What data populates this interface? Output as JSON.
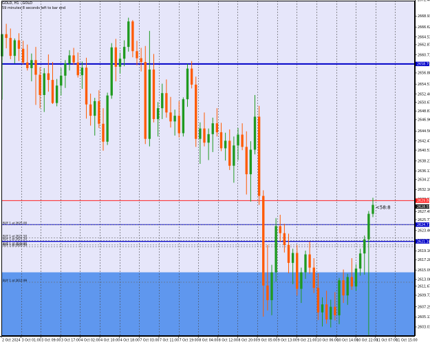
{
  "header": {
    "symbol_line": "GOLD, H1 - GOLD",
    "timer_line": "59 minutes 8 seconds left to bar end"
  },
  "colors": {
    "background": "#e6e6fa",
    "grid": "#4a4a4a",
    "bull": "#1f9a1f",
    "bear": "#ff5a00",
    "blue_line": "#0000c8",
    "red_line": "#ff2020",
    "zone": "#5f97ee",
    "axis_bg": "#ffffff"
  },
  "price_axis": {
    "min": 2601.1,
    "max": 2672.2,
    "ticks": [
      "2672.40",
      "2668.93",
      "2666.62",
      "2664.53",
      "2662.87",
      "2660.71",
      "2658.79",
      "2656.88",
      "2654.51",
      "2652.40",
      "2650.67",
      "2648.81",
      "2646.96",
      "2644.56",
      "2642.47",
      "2640.51",
      "2638.21",
      "2636.11",
      "2634.27",
      "2632.16",
      "2630.11",
      "2627.49",
      "2625.77",
      "2623.46",
      "2621.39",
      "2619.16",
      "2617.28",
      "2615.09",
      "2613.08",
      "2611.67",
      "2609.73",
      "2607.29",
      "2605.13",
      "2603.01"
    ],
    "markers": [
      {
        "label": "2658.79",
        "color": "#0000c8"
      },
      {
        "label": "2629.80",
        "color": "#ff2020"
      },
      {
        "label": "2628.55",
        "color": "#1a1a1a"
      },
      {
        "label": "2624.71",
        "color": "#0000c8"
      },
      {
        "label": "2621.16",
        "color": "#0000c8"
      }
    ]
  },
  "time_axis": {
    "labels": [
      "2 Oct 2024",
      "3 Oct 01:00",
      "3 Oct 09:00",
      "3 Oct 17:00",
      "4 Oct 02:00",
      "4 Oct 10:00",
      "4 Oct 18:00",
      "7 Oct 03:00",
      "7 Oct 11:00",
      "7 Oct 19:00",
      "8 Oct 04:00",
      "8 Oct 12:00",
      "8 Oct 20:00",
      "9 Oct 05:00",
      "9 Oct 13:00",
      "9 Oct 21:00",
      "10 Oct 06:00",
      "10 Oct 14:00",
      "10 Oct 22:00",
      "11 Oct 07:00",
      "11 Oct 15:00"
    ]
  },
  "levels": {
    "blue_top": 2658.79,
    "red_line": 2629.8,
    "blue_mid1": 2624.71,
    "blue_mid2": 2621.16
  },
  "zone": {
    "from": 2601.1,
    "to": 2614.6
  },
  "orders": [
    {
      "label": "BUY 1 at 2625.00",
      "price": 2624.71
    },
    {
      "label": "BUY 1 at 2621.50",
      "price": 2621.9
    },
    {
      "label": "BUY 1 at 2621.20",
      "price": 2621.3
    },
    {
      "label": "BUY 1 at 2620.80",
      "price": 2620.4
    },
    {
      "label": "BUY 1 at 2620.50",
      "price": 2620.0
    },
    {
      "label": "BUY 1 at 2612.99",
      "price": 2612.5
    }
  ],
  "current_price_label": "<58:8",
  "chart_data": {
    "type": "candlestick",
    "series": [
      {
        "o": 2660.4,
        "h": 2665.1,
        "l": 2651.2,
        "c": 2665.1
      },
      {
        "o": 2665.1,
        "h": 2667.3,
        "l": 2662.1,
        "c": 2664.3
      },
      {
        "o": 2664.3,
        "h": 2666.3,
        "l": 2659.8,
        "c": 2660.5
      },
      {
        "o": 2660.5,
        "h": 2664.2,
        "l": 2658.9,
        "c": 2663.8
      },
      {
        "o": 2663.8,
        "h": 2665.3,
        "l": 2659.4,
        "c": 2662.0
      },
      {
        "o": 2662.0,
        "h": 2663.7,
        "l": 2658.7,
        "c": 2659.1
      },
      {
        "o": 2659.1,
        "h": 2662.9,
        "l": 2657.4,
        "c": 2657.9
      },
      {
        "o": 2657.9,
        "h": 2661.0,
        "l": 2655.1,
        "c": 2659.6
      },
      {
        "o": 2659.6,
        "h": 2662.4,
        "l": 2650.1,
        "c": 2656.5
      },
      {
        "o": 2656.5,
        "h": 2658.1,
        "l": 2649.4,
        "c": 2652.2
      },
      {
        "o": 2652.2,
        "h": 2657.9,
        "l": 2648.6,
        "c": 2656.8
      },
      {
        "o": 2656.8,
        "h": 2660.8,
        "l": 2652.9,
        "c": 2655.4
      },
      {
        "o": 2655.4,
        "h": 2659.2,
        "l": 2650.3,
        "c": 2650.5
      },
      {
        "o": 2650.5,
        "h": 2655.6,
        "l": 2649.8,
        "c": 2654.2
      },
      {
        "o": 2654.2,
        "h": 2657.9,
        "l": 2652.1,
        "c": 2656.3
      },
      {
        "o": 2656.3,
        "h": 2659.6,
        "l": 2653.7,
        "c": 2658.9
      },
      {
        "o": 2658.9,
        "h": 2661.7,
        "l": 2657.4,
        "c": 2660.6
      },
      {
        "o": 2660.6,
        "h": 2662.2,
        "l": 2658.6,
        "c": 2659.1
      },
      {
        "o": 2659.1,
        "h": 2661.2,
        "l": 2655.9,
        "c": 2656.4
      },
      {
        "o": 2656.4,
        "h": 2659.3,
        "l": 2653.5,
        "c": 2658.0
      },
      {
        "o": 2658.0,
        "h": 2660.1,
        "l": 2647.2,
        "c": 2650.2
      },
      {
        "o": 2650.2,
        "h": 2652.5,
        "l": 2645.7,
        "c": 2647.8
      },
      {
        "o": 2647.8,
        "h": 2651.6,
        "l": 2643.6,
        "c": 2650.9
      },
      {
        "o": 2650.9,
        "h": 2653.2,
        "l": 2645.2,
        "c": 2646.1
      },
      {
        "o": 2646.1,
        "h": 2649.4,
        "l": 2640.4,
        "c": 2642.3
      },
      {
        "o": 2642.3,
        "h": 2652.7,
        "l": 2641.6,
        "c": 2652.1
      },
      {
        "o": 2652.1,
        "h": 2663.2,
        "l": 2651.4,
        "c": 2662.3
      },
      {
        "o": 2662.3,
        "h": 2664.1,
        "l": 2655.1,
        "c": 2658.2
      },
      {
        "o": 2658.2,
        "h": 2661.2,
        "l": 2656.7,
        "c": 2659.9
      },
      {
        "o": 2659.9,
        "h": 2663.8,
        "l": 2658.3,
        "c": 2662.4
      },
      {
        "o": 2662.4,
        "h": 2668.6,
        "l": 2661.4,
        "c": 2667.8
      },
      {
        "o": 2667.8,
        "h": 2668.1,
        "l": 2660.2,
        "c": 2661.5
      },
      {
        "o": 2661.5,
        "h": 2663.7,
        "l": 2658.5,
        "c": 2660.0
      },
      {
        "o": 2660.0,
        "h": 2662.2,
        "l": 2657.2,
        "c": 2659.2
      },
      {
        "o": 2659.2,
        "h": 2662.6,
        "l": 2641.8,
        "c": 2642.9
      },
      {
        "o": 2642.9,
        "h": 2665.8,
        "l": 2641.3,
        "c": 2657.6
      },
      {
        "o": 2657.6,
        "h": 2660.9,
        "l": 2646.4,
        "c": 2647.1
      },
      {
        "o": 2647.1,
        "h": 2650.7,
        "l": 2643.4,
        "c": 2649.4
      },
      {
        "o": 2649.4,
        "h": 2654.6,
        "l": 2647.1,
        "c": 2652.6
      },
      {
        "o": 2652.6,
        "h": 2655.5,
        "l": 2647.4,
        "c": 2648.5
      },
      {
        "o": 2648.5,
        "h": 2651.8,
        "l": 2645.3,
        "c": 2646.6
      },
      {
        "o": 2646.6,
        "h": 2649.1,
        "l": 2643.6,
        "c": 2647.8
      },
      {
        "o": 2647.8,
        "h": 2650.9,
        "l": 2643.2,
        "c": 2644.1
      },
      {
        "o": 2644.1,
        "h": 2651.7,
        "l": 2643.4,
        "c": 2651.3
      },
      {
        "o": 2651.3,
        "h": 2658.8,
        "l": 2649.7,
        "c": 2657.8
      },
      {
        "o": 2657.8,
        "h": 2659.4,
        "l": 2653.6,
        "c": 2654.4
      },
      {
        "o": 2654.4,
        "h": 2656.1,
        "l": 2641.2,
        "c": 2642.9
      },
      {
        "o": 2642.9,
        "h": 2646.4,
        "l": 2637.6,
        "c": 2645.1
      },
      {
        "o": 2645.1,
        "h": 2648.5,
        "l": 2641.3,
        "c": 2642.1
      },
      {
        "o": 2642.1,
        "h": 2645.1,
        "l": 2638.4,
        "c": 2643.9
      },
      {
        "o": 2643.9,
        "h": 2647.4,
        "l": 2640.1,
        "c": 2646.2
      },
      {
        "o": 2646.2,
        "h": 2649.4,
        "l": 2643.4,
        "c": 2644.3
      },
      {
        "o": 2644.3,
        "h": 2646.3,
        "l": 2640.3,
        "c": 2640.9
      },
      {
        "o": 2640.9,
        "h": 2644.2,
        "l": 2638.3,
        "c": 2642.5
      },
      {
        "o": 2642.5,
        "h": 2644.9,
        "l": 2636.3,
        "c": 2637.2
      },
      {
        "o": 2637.2,
        "h": 2643.4,
        "l": 2633.6,
        "c": 2641.5
      },
      {
        "o": 2641.5,
        "h": 2645.2,
        "l": 2638.4,
        "c": 2643.8
      },
      {
        "o": 2643.8,
        "h": 2646.2,
        "l": 2640.5,
        "c": 2641.2
      },
      {
        "o": 2641.2,
        "h": 2644.5,
        "l": 2631.1,
        "c": 2635.4
      },
      {
        "o": 2635.4,
        "h": 2642.4,
        "l": 2629.6,
        "c": 2640.6
      },
      {
        "o": 2640.6,
        "h": 2652.2,
        "l": 2639.6,
        "c": 2647.6
      },
      {
        "o": 2647.6,
        "h": 2649.9,
        "l": 2628.9,
        "c": 2630.8
      },
      {
        "o": 2630.8,
        "h": 2632.0,
        "l": 2605.2,
        "c": 2611.8
      },
      {
        "o": 2611.8,
        "h": 2620.4,
        "l": 2606.5,
        "c": 2608.7
      },
      {
        "o": 2608.7,
        "h": 2616.2,
        "l": 2605.5,
        "c": 2614.6
      },
      {
        "o": 2614.6,
        "h": 2626.1,
        "l": 2612.6,
        "c": 2624.4
      },
      {
        "o": 2624.4,
        "h": 2626.8,
        "l": 2621.1,
        "c": 2622.9
      },
      {
        "o": 2622.9,
        "h": 2624.9,
        "l": 2618.8,
        "c": 2620.4
      },
      {
        "o": 2620.4,
        "h": 2622.8,
        "l": 2614.4,
        "c": 2616.6
      },
      {
        "o": 2616.6,
        "h": 2619.6,
        "l": 2612.1,
        "c": 2618.7
      },
      {
        "o": 2618.7,
        "h": 2620.4,
        "l": 2609.7,
        "c": 2611.1
      },
      {
        "o": 2611.1,
        "h": 2615.6,
        "l": 2608.1,
        "c": 2614.6
      },
      {
        "o": 2614.6,
        "h": 2619.2,
        "l": 2613.2,
        "c": 2618.4
      },
      {
        "o": 2618.4,
        "h": 2621.1,
        "l": 2614.3,
        "c": 2615.6
      },
      {
        "o": 2615.6,
        "h": 2617.6,
        "l": 2610.2,
        "c": 2611.3
      },
      {
        "o": 2611.3,
        "h": 2614.4,
        "l": 2604.5,
        "c": 2606.1
      },
      {
        "o": 2606.1,
        "h": 2609.3,
        "l": 2603.1,
        "c": 2607.8
      },
      {
        "o": 2607.8,
        "h": 2610.7,
        "l": 2603.7,
        "c": 2604.6
      },
      {
        "o": 2604.6,
        "h": 2608.8,
        "l": 2602.9,
        "c": 2607.3
      },
      {
        "o": 2607.3,
        "h": 2610.4,
        "l": 2604.4,
        "c": 2605.5
      },
      {
        "o": 2605.5,
        "h": 2613.4,
        "l": 2603.6,
        "c": 2612.9
      },
      {
        "o": 2612.9,
        "h": 2615.2,
        "l": 2608.1,
        "c": 2609.7
      },
      {
        "o": 2609.7,
        "h": 2614.3,
        "l": 2607.7,
        "c": 2613.6
      },
      {
        "o": 2613.6,
        "h": 2617.6,
        "l": 2610.9,
        "c": 2611.6
      },
      {
        "o": 2611.6,
        "h": 2616.3,
        "l": 2610.6,
        "c": 2615.4
      },
      {
        "o": 2615.4,
        "h": 2619.6,
        "l": 2613.9,
        "c": 2618.6
      },
      {
        "o": 2618.6,
        "h": 2622.4,
        "l": 2614.1,
        "c": 2621.6
      },
      {
        "o": 2621.6,
        "h": 2627.6,
        "l": 2601.3,
        "c": 2627.0
      },
      {
        "o": 2627.0,
        "h": 2630.4,
        "l": 2626.3,
        "c": 2628.9
      }
    ]
  }
}
